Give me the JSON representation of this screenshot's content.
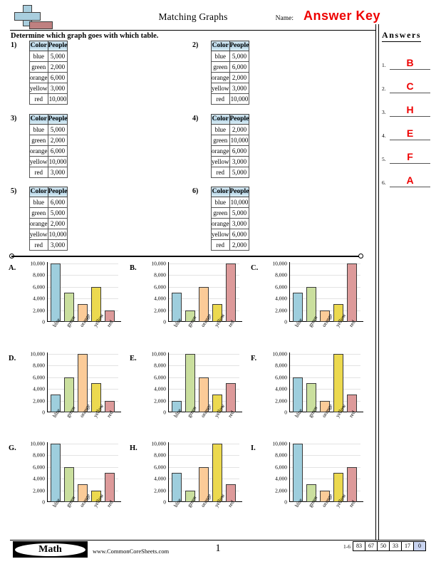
{
  "header": {
    "title": "Matching Graphs",
    "name_label": "Name:",
    "answer_key": "Answer Key",
    "logo_icon": "plus-book-logo-icon"
  },
  "instruction": "Determine which graph goes with which table.",
  "answers_panel": {
    "title": "Answers",
    "rows": [
      {
        "num": "1.",
        "value": "B"
      },
      {
        "num": "2.",
        "value": "C"
      },
      {
        "num": "3.",
        "value": "H"
      },
      {
        "num": "4.",
        "value": "E"
      },
      {
        "num": "5.",
        "value": "F"
      },
      {
        "num": "6.",
        "value": "A"
      }
    ]
  },
  "table_headers": [
    "Color",
    "People"
  ],
  "tables": [
    {
      "num": "1)",
      "rows": [
        [
          "blue",
          "5,000"
        ],
        [
          "green",
          "2,000"
        ],
        [
          "orange",
          "6,000"
        ],
        [
          "yellow",
          "3,000"
        ],
        [
          "red",
          "10,000"
        ]
      ]
    },
    {
      "num": "2)",
      "rows": [
        [
          "blue",
          "5,000"
        ],
        [
          "green",
          "6,000"
        ],
        [
          "orange",
          "2,000"
        ],
        [
          "yellow",
          "3,000"
        ],
        [
          "red",
          "10,000"
        ]
      ]
    },
    {
      "num": "3)",
      "rows": [
        [
          "blue",
          "5,000"
        ],
        [
          "green",
          "2,000"
        ],
        [
          "orange",
          "6,000"
        ],
        [
          "yellow",
          "10,000"
        ],
        [
          "red",
          "3,000"
        ]
      ]
    },
    {
      "num": "4)",
      "rows": [
        [
          "blue",
          "2,000"
        ],
        [
          "green",
          "10,000"
        ],
        [
          "orange",
          "6,000"
        ],
        [
          "yellow",
          "3,000"
        ],
        [
          "red",
          "5,000"
        ]
      ]
    },
    {
      "num": "5)",
      "rows": [
        [
          "blue",
          "6,000"
        ],
        [
          "green",
          "5,000"
        ],
        [
          "orange",
          "2,000"
        ],
        [
          "yellow",
          "10,000"
        ],
        [
          "red",
          "3,000"
        ]
      ]
    },
    {
      "num": "6)",
      "rows": [
        [
          "blue",
          "10,000"
        ],
        [
          "green",
          "5,000"
        ],
        [
          "orange",
          "3,000"
        ],
        [
          "yellow",
          "6,000"
        ],
        [
          "red",
          "2,000"
        ]
      ]
    }
  ],
  "chart_data": [
    {
      "type": "bar",
      "title": "A.",
      "categories": [
        "blue",
        "green",
        "orange",
        "yellow",
        "red"
      ],
      "values": [
        10000,
        5000,
        3000,
        6000,
        2000
      ],
      "ytick_labels": [
        "10,000",
        "8,000",
        "6,000",
        "4,000",
        "2,000",
        "0"
      ],
      "ylim": [
        0,
        10000
      ],
      "xlabel": "",
      "ylabel": "",
      "grid": true,
      "legend": "none"
    },
    {
      "type": "bar",
      "title": "B.",
      "categories": [
        "blue",
        "green",
        "orange",
        "yellow",
        "red"
      ],
      "values": [
        5000,
        2000,
        6000,
        3000,
        10000
      ],
      "ytick_labels": [
        "10,000",
        "8,000",
        "6,000",
        "4,000",
        "2,000",
        "0"
      ],
      "ylim": [
        0,
        10000
      ],
      "xlabel": "",
      "ylabel": "",
      "grid": true,
      "legend": "none"
    },
    {
      "type": "bar",
      "title": "C.",
      "categories": [
        "blue",
        "green",
        "orange",
        "yellow",
        "red"
      ],
      "values": [
        5000,
        6000,
        2000,
        3000,
        10000
      ],
      "ytick_labels": [
        "10,000",
        "8,000",
        "6,000",
        "4,000",
        "2,000",
        "0"
      ],
      "ylim": [
        0,
        10000
      ],
      "xlabel": "",
      "ylabel": "",
      "grid": true,
      "legend": "none"
    },
    {
      "type": "bar",
      "title": "D.",
      "categories": [
        "blue",
        "green",
        "orange",
        "yellow",
        "red"
      ],
      "values": [
        3000,
        6000,
        10000,
        5000,
        2000
      ],
      "ytick_labels": [
        "10,000",
        "8,000",
        "6,000",
        "4,000",
        "2,000",
        "0"
      ],
      "ylim": [
        0,
        10000
      ],
      "xlabel": "",
      "ylabel": "",
      "grid": true,
      "legend": "none"
    },
    {
      "type": "bar",
      "title": "E.",
      "categories": [
        "blue",
        "green",
        "orange",
        "yellow",
        "red"
      ],
      "values": [
        2000,
        10000,
        6000,
        3000,
        5000
      ],
      "ytick_labels": [
        "10,000",
        "8,000",
        "6,000",
        "4,000",
        "2,000",
        "0"
      ],
      "ylim": [
        0,
        10000
      ],
      "xlabel": "",
      "ylabel": "",
      "grid": true,
      "legend": "none"
    },
    {
      "type": "bar",
      "title": "F.",
      "categories": [
        "blue",
        "green",
        "orange",
        "yellow",
        "red"
      ],
      "values": [
        6000,
        5000,
        2000,
        10000,
        3000
      ],
      "ytick_labels": [
        "10,000",
        "8,000",
        "6,000",
        "4,000",
        "2,000",
        "0"
      ],
      "ylim": [
        0,
        10000
      ],
      "xlabel": "",
      "ylabel": "",
      "grid": true,
      "legend": "none"
    },
    {
      "type": "bar",
      "title": "G.",
      "categories": [
        "blue",
        "green",
        "orange",
        "yellow",
        "red"
      ],
      "values": [
        10000,
        6000,
        3000,
        2000,
        5000
      ],
      "ytick_labels": [
        "10,000",
        "8,000",
        "6,000",
        "4,000",
        "2,000",
        "0"
      ],
      "ylim": [
        0,
        10000
      ],
      "xlabel": "",
      "ylabel": "",
      "grid": true,
      "legend": "none"
    },
    {
      "type": "bar",
      "title": "H.",
      "categories": [
        "blue",
        "green",
        "orange",
        "yellow",
        "red"
      ],
      "values": [
        5000,
        2000,
        6000,
        10000,
        3000
      ],
      "ytick_labels": [
        "10,000",
        "8,000",
        "6,000",
        "4,000",
        "2,000",
        "0"
      ],
      "ylim": [
        0,
        10000
      ],
      "xlabel": "",
      "ylabel": "",
      "grid": true,
      "legend": "none"
    },
    {
      "type": "bar",
      "title": "I.",
      "categories": [
        "blue",
        "green",
        "orange",
        "yellow",
        "red"
      ],
      "values": [
        10000,
        3000,
        2000,
        5000,
        6000
      ],
      "ytick_labels": [
        "10,000",
        "8,000",
        "6,000",
        "4,000",
        "2,000",
        "0"
      ],
      "ylim": [
        0,
        10000
      ],
      "xlabel": "",
      "ylabel": "",
      "grid": true,
      "legend": "none"
    }
  ],
  "bar_colors": {
    "blue": "#9ecedd",
    "green": "#cadf9e",
    "orange": "#fbcb98",
    "yellow": "#ecd94f",
    "red": "#dd9a9a"
  },
  "footer": {
    "subject": "Math",
    "url": "www.CommonCoreSheets.com",
    "page": "1",
    "score_range": "1-6",
    "score_cells": [
      "83",
      "67",
      "50",
      "33",
      "17",
      "0"
    ],
    "score_highlight_index": 5
  }
}
